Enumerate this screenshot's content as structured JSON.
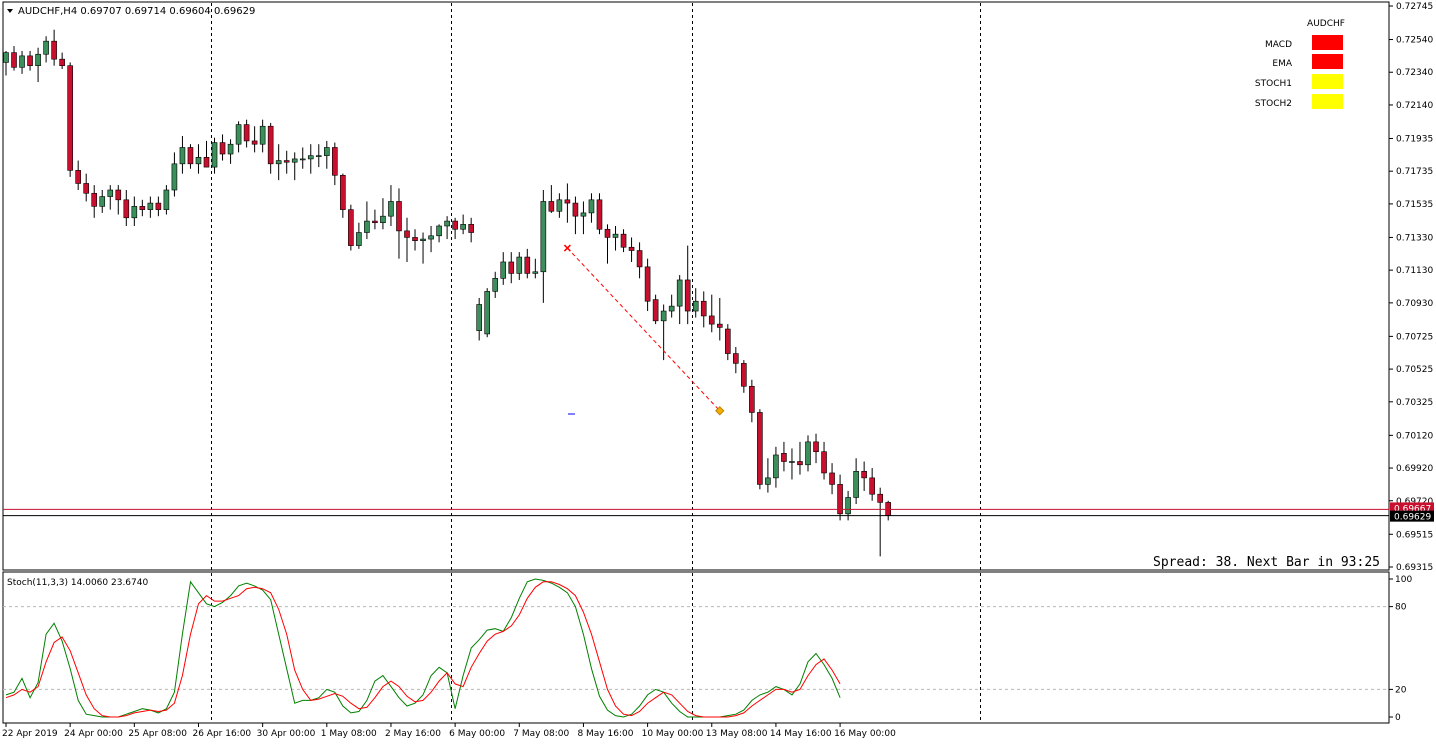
{
  "header": {
    "symbol_line": "AUDCHF,H4  0.69707 0.69714 0.69604 0.69629"
  },
  "status": {
    "spread_text": "Spread: 38. Next Bar in 93:25"
  },
  "dashboard": {
    "title": "AUDCHF",
    "rows": [
      {
        "label": "MACD",
        "color": "#ff0000"
      },
      {
        "label": "EMA",
        "color": "#ff0000"
      },
      {
        "label": "STOCH1",
        "color": "#ffff00"
      },
      {
        "label": "STOCH2",
        "color": "#ffff00"
      }
    ]
  },
  "stoch_label": "Stoch(11,3,3) 14.0060 23.6740",
  "colors": {
    "bull": "#3a8f5a",
    "bear": "#c8102e",
    "stoch_main": "#008000",
    "stoch_signal": "#ff0000",
    "bid_line": "#000000",
    "ask_line": "#c8102e",
    "trend_line": "#ff0000"
  },
  "chart_data": [
    {
      "type": "candlestick",
      "symbol": "AUDCHF",
      "timeframe": "H4",
      "ylim": [
        0.69315,
        0.72745
      ],
      "y_ticks": [
        "0.72745",
        "0.72540",
        "0.72340",
        "0.72140",
        "0.71935",
        "0.71735",
        "0.71535",
        "0.71330",
        "0.71130",
        "0.70930",
        "0.70725",
        "0.70525",
        "0.70325",
        "0.70120",
        "0.69920",
        "0.69720",
        "0.69515",
        "0.69315"
      ],
      "x_ticks": [
        {
          "index": 0,
          "label": "22 Apr 2019"
        },
        {
          "index": 8,
          "label": "24 Apr 00:00"
        },
        {
          "index": 16,
          "label": "25 Apr 08:00"
        },
        {
          "index": 24,
          "label": "26 Apr 16:00"
        },
        {
          "index": 32,
          "label": "30 Apr 00:00"
        },
        {
          "index": 40,
          "label": "1 May 08:00"
        },
        {
          "index": 48,
          "label": "2 May 16:00"
        },
        {
          "index": 56,
          "label": "6 May 00:00"
        },
        {
          "index": 64,
          "label": "7 May 08:00"
        },
        {
          "index": 72,
          "label": "8 May 16:00"
        },
        {
          "index": 80,
          "label": "10 May 00:00"
        },
        {
          "index": 88,
          "label": "13 May 08:00"
        },
        {
          "index": 96,
          "label": "14 May 16:00"
        },
        {
          "index": 104,
          "label": "16 May 00:00"
        }
      ],
      "price_labels": [
        {
          "value": 0.69667,
          "text": "0.69667",
          "color": "#c8102e"
        },
        {
          "value": 0.69629,
          "text": "0.69629",
          "color": "#000000"
        }
      ],
      "period_separators": [
        26,
        56,
        86,
        122
      ],
      "trendline": {
        "from": [
          70,
          0.71265
        ],
        "to": [
          89,
          0.7027
        ]
      },
      "candles": [
        {
          "o": 0.724,
          "h": 0.7247,
          "l": 0.7232,
          "c": 0.7246
        },
        {
          "o": 0.7246,
          "h": 0.725,
          "l": 0.7235,
          "c": 0.7237
        },
        {
          "o": 0.7237,
          "h": 0.7247,
          "l": 0.7233,
          "c": 0.7244
        },
        {
          "o": 0.7244,
          "h": 0.7247,
          "l": 0.7235,
          "c": 0.7238
        },
        {
          "o": 0.7238,
          "h": 0.7249,
          "l": 0.7228,
          "c": 0.7245
        },
        {
          "o": 0.7245,
          "h": 0.7256,
          "l": 0.724,
          "c": 0.7253
        },
        {
          "o": 0.7253,
          "h": 0.726,
          "l": 0.7238,
          "c": 0.7242
        },
        {
          "o": 0.7242,
          "h": 0.7246,
          "l": 0.7236,
          "c": 0.7238
        },
        {
          "o": 0.7238,
          "h": 0.724,
          "l": 0.717,
          "c": 0.7174
        },
        {
          "o": 0.7174,
          "h": 0.718,
          "l": 0.7162,
          "c": 0.7166
        },
        {
          "o": 0.7166,
          "h": 0.7172,
          "l": 0.7155,
          "c": 0.716
        },
        {
          "o": 0.716,
          "h": 0.7165,
          "l": 0.7145,
          "c": 0.7152
        },
        {
          "o": 0.7152,
          "h": 0.7162,
          "l": 0.7148,
          "c": 0.7158
        },
        {
          "o": 0.7158,
          "h": 0.7165,
          "l": 0.715,
          "c": 0.7162
        },
        {
          "o": 0.7162,
          "h": 0.7165,
          "l": 0.7147,
          "c": 0.7156
        },
        {
          "o": 0.7156,
          "h": 0.7162,
          "l": 0.714,
          "c": 0.7145
        },
        {
          "o": 0.7145,
          "h": 0.7158,
          "l": 0.714,
          "c": 0.7152
        },
        {
          "o": 0.7152,
          "h": 0.7156,
          "l": 0.7146,
          "c": 0.715
        },
        {
          "o": 0.715,
          "h": 0.7158,
          "l": 0.7145,
          "c": 0.7154
        },
        {
          "o": 0.7154,
          "h": 0.7158,
          "l": 0.7146,
          "c": 0.715
        },
        {
          "o": 0.715,
          "h": 0.7165,
          "l": 0.7147,
          "c": 0.7162
        },
        {
          "o": 0.7162,
          "h": 0.7185,
          "l": 0.7158,
          "c": 0.7178
        },
        {
          "o": 0.7178,
          "h": 0.7195,
          "l": 0.7172,
          "c": 0.7188
        },
        {
          "o": 0.7188,
          "h": 0.719,
          "l": 0.7175,
          "c": 0.7178
        },
        {
          "o": 0.7178,
          "h": 0.719,
          "l": 0.7172,
          "c": 0.7182
        },
        {
          "o": 0.7182,
          "h": 0.7192,
          "l": 0.7176,
          "c": 0.7176
        },
        {
          "o": 0.7176,
          "h": 0.7194,
          "l": 0.7172,
          "c": 0.7191
        },
        {
          "o": 0.7191,
          "h": 0.7196,
          "l": 0.718,
          "c": 0.7184
        },
        {
          "o": 0.7184,
          "h": 0.7193,
          "l": 0.7178,
          "c": 0.719
        },
        {
          "o": 0.719,
          "h": 0.7204,
          "l": 0.7185,
          "c": 0.7202
        },
        {
          "o": 0.7202,
          "h": 0.7205,
          "l": 0.7188,
          "c": 0.7192
        },
        {
          "o": 0.7192,
          "h": 0.7201,
          "l": 0.7185,
          "c": 0.719
        },
        {
          "o": 0.719,
          "h": 0.7205,
          "l": 0.7185,
          "c": 0.7201
        },
        {
          "o": 0.7201,
          "h": 0.7203,
          "l": 0.7172,
          "c": 0.7178
        },
        {
          "o": 0.7178,
          "h": 0.719,
          "l": 0.7168,
          "c": 0.718
        },
        {
          "o": 0.718,
          "h": 0.7186,
          "l": 0.7172,
          "c": 0.7179
        },
        {
          "o": 0.7179,
          "h": 0.7185,
          "l": 0.7168,
          "c": 0.7181
        },
        {
          "o": 0.7181,
          "h": 0.7188,
          "l": 0.7175,
          "c": 0.7181
        },
        {
          "o": 0.7181,
          "h": 0.719,
          "l": 0.7172,
          "c": 0.7183
        },
        {
          "o": 0.7183,
          "h": 0.719,
          "l": 0.7176,
          "c": 0.7183
        },
        {
          "o": 0.7183,
          "h": 0.7192,
          "l": 0.7175,
          "c": 0.7188
        },
        {
          "o": 0.7188,
          "h": 0.7191,
          "l": 0.7165,
          "c": 0.7171
        },
        {
          "o": 0.7171,
          "h": 0.7172,
          "l": 0.7145,
          "c": 0.715
        },
        {
          "o": 0.715,
          "h": 0.7153,
          "l": 0.7125,
          "c": 0.7128
        },
        {
          "o": 0.7128,
          "h": 0.7142,
          "l": 0.7126,
          "c": 0.7136
        },
        {
          "o": 0.7136,
          "h": 0.7155,
          "l": 0.7132,
          "c": 0.7143
        },
        {
          "o": 0.7143,
          "h": 0.715,
          "l": 0.7138,
          "c": 0.7142
        },
        {
          "o": 0.7142,
          "h": 0.7157,
          "l": 0.7138,
          "c": 0.7146
        },
        {
          "o": 0.7146,
          "h": 0.7165,
          "l": 0.714,
          "c": 0.7155
        },
        {
          "o": 0.7155,
          "h": 0.7163,
          "l": 0.712,
          "c": 0.7137
        },
        {
          "o": 0.7137,
          "h": 0.7145,
          "l": 0.7118,
          "c": 0.7133
        },
        {
          "o": 0.7133,
          "h": 0.7138,
          "l": 0.7125,
          "c": 0.7131
        },
        {
          "o": 0.7131,
          "h": 0.7136,
          "l": 0.7117,
          "c": 0.7132
        },
        {
          "o": 0.7132,
          "h": 0.714,
          "l": 0.7124,
          "c": 0.7134
        },
        {
          "o": 0.7134,
          "h": 0.7141,
          "l": 0.713,
          "c": 0.714
        },
        {
          "o": 0.714,
          "h": 0.7146,
          "l": 0.7132,
          "c": 0.7143
        },
        {
          "o": 0.7143,
          "h": 0.7145,
          "l": 0.7132,
          "c": 0.7138
        },
        {
          "o": 0.7138,
          "h": 0.7147,
          "l": 0.7135,
          "c": 0.7141
        },
        {
          "o": 0.7141,
          "h": 0.7145,
          "l": 0.713,
          "c": 0.7136
        },
        {
          "o": 0.7076,
          "h": 0.7096,
          "l": 0.707,
          "c": 0.7092
        },
        {
          "o": 0.7074,
          "h": 0.7102,
          "l": 0.7072,
          "c": 0.71
        },
        {
          "o": 0.71,
          "h": 0.7112,
          "l": 0.7096,
          "c": 0.7108
        },
        {
          "o": 0.7108,
          "h": 0.7124,
          "l": 0.7104,
          "c": 0.7118
        },
        {
          "o": 0.7118,
          "h": 0.7124,
          "l": 0.7105,
          "c": 0.7111
        },
        {
          "o": 0.7111,
          "h": 0.7124,
          "l": 0.7107,
          "c": 0.7121
        },
        {
          "o": 0.7121,
          "h": 0.7126,
          "l": 0.7108,
          "c": 0.7111
        },
        {
          "o": 0.7111,
          "h": 0.712,
          "l": 0.7108,
          "c": 0.7112
        },
        {
          "o": 0.7112,
          "h": 0.7162,
          "l": 0.7093,
          "c": 0.7155
        },
        {
          "o": 0.7155,
          "h": 0.7165,
          "l": 0.7148,
          "c": 0.7149
        },
        {
          "o": 0.7149,
          "h": 0.716,
          "l": 0.7145,
          "c": 0.7156
        },
        {
          "o": 0.7156,
          "h": 0.7166,
          "l": 0.7142,
          "c": 0.7154
        },
        {
          "o": 0.7154,
          "h": 0.7158,
          "l": 0.7135,
          "c": 0.7146
        },
        {
          "o": 0.7146,
          "h": 0.7155,
          "l": 0.7135,
          "c": 0.7148
        },
        {
          "o": 0.7148,
          "h": 0.716,
          "l": 0.7142,
          "c": 0.7156
        },
        {
          "o": 0.7156,
          "h": 0.716,
          "l": 0.7135,
          "c": 0.7138
        },
        {
          "o": 0.7138,
          "h": 0.7141,
          "l": 0.7117,
          "c": 0.7133
        },
        {
          "o": 0.7133,
          "h": 0.714,
          "l": 0.7125,
          "c": 0.7135
        },
        {
          "o": 0.7135,
          "h": 0.7138,
          "l": 0.7124,
          "c": 0.7127
        },
        {
          "o": 0.7127,
          "h": 0.7133,
          "l": 0.7118,
          "c": 0.7125
        },
        {
          "o": 0.7125,
          "h": 0.713,
          "l": 0.7108,
          "c": 0.7115
        },
        {
          "o": 0.7115,
          "h": 0.712,
          "l": 0.7088,
          "c": 0.7094
        },
        {
          "o": 0.7095,
          "h": 0.7098,
          "l": 0.708,
          "c": 0.7082
        },
        {
          "o": 0.7082,
          "h": 0.7092,
          "l": 0.7058,
          "c": 0.7088
        },
        {
          "o": 0.7088,
          "h": 0.7098,
          "l": 0.7084,
          "c": 0.7091
        },
        {
          "o": 0.7091,
          "h": 0.711,
          "l": 0.708,
          "c": 0.7107
        },
        {
          "o": 0.7107,
          "h": 0.7128,
          "l": 0.708,
          "c": 0.7088
        },
        {
          "o": 0.7088,
          "h": 0.7102,
          "l": 0.7084,
          "c": 0.7094
        },
        {
          "o": 0.7094,
          "h": 0.71,
          "l": 0.7078,
          "c": 0.7085
        },
        {
          "o": 0.7085,
          "h": 0.7098,
          "l": 0.7075,
          "c": 0.708
        },
        {
          "o": 0.708,
          "h": 0.7096,
          "l": 0.707,
          "c": 0.7078
        },
        {
          "o": 0.7077,
          "h": 0.708,
          "l": 0.7058,
          "c": 0.7062
        },
        {
          "o": 0.7062,
          "h": 0.7066,
          "l": 0.705,
          "c": 0.7056
        },
        {
          "o": 0.7056,
          "h": 0.7058,
          "l": 0.7038,
          "c": 0.7042
        },
        {
          "o": 0.7042,
          "h": 0.7046,
          "l": 0.702,
          "c": 0.7026
        },
        {
          "o": 0.7026,
          "h": 0.7028,
          "l": 0.6979,
          "c": 0.6982
        },
        {
          "o": 0.6982,
          "h": 0.6998,
          "l": 0.6977,
          "c": 0.6986
        },
        {
          "o": 0.6986,
          "h": 0.7005,
          "l": 0.698,
          "c": 0.7
        },
        {
          "o": 0.7001,
          "h": 0.7008,
          "l": 0.699,
          "c": 0.6996
        },
        {
          "o": 0.6996,
          "h": 0.7004,
          "l": 0.6985,
          "c": 0.6996
        },
        {
          "o": 0.6996,
          "h": 0.7008,
          "l": 0.6988,
          "c": 0.6994
        },
        {
          "o": 0.6994,
          "h": 0.7012,
          "l": 0.699,
          "c": 0.7008
        },
        {
          "o": 0.7008,
          "h": 0.7013,
          "l": 0.6995,
          "c": 0.7002
        },
        {
          "o": 0.7002,
          "h": 0.7008,
          "l": 0.6985,
          "c": 0.6989
        },
        {
          "o": 0.6989,
          "h": 0.6995,
          "l": 0.6976,
          "c": 0.6982
        },
        {
          "o": 0.6982,
          "h": 0.6988,
          "l": 0.696,
          "c": 0.6964
        },
        {
          "o": 0.6964,
          "h": 0.6978,
          "l": 0.696,
          "c": 0.6974
        },
        {
          "o": 0.6974,
          "h": 0.6998,
          "l": 0.697,
          "c": 0.699
        },
        {
          "o": 0.699,
          "h": 0.6996,
          "l": 0.6978,
          "c": 0.6986
        },
        {
          "o": 0.6986,
          "h": 0.6992,
          "l": 0.6972,
          "c": 0.6976
        },
        {
          "o": 0.6976,
          "h": 0.698,
          "l": 0.6938,
          "c": 0.6971
        },
        {
          "o": 0.6971,
          "h": 0.6972,
          "l": 0.696,
          "c": 0.6963
        }
      ]
    },
    {
      "type": "line",
      "name": "Stoch(11,3,3)",
      "ylim": [
        0,
        100
      ],
      "y_ticks": [
        "100",
        "80",
        "20",
        "0"
      ],
      "levels": [
        80,
        20
      ],
      "series": [
        {
          "name": "main",
          "values": [
            16,
            18,
            28,
            14,
            25,
            60,
            68,
            55,
            35,
            12,
            2,
            1,
            0,
            0,
            0,
            2,
            4,
            6,
            5,
            3,
            6,
            18,
            60,
            98,
            90,
            82,
            80,
            83,
            88,
            95,
            97,
            95,
            92,
            85,
            60,
            35,
            10,
            12,
            12,
            14,
            20,
            18,
            8,
            3,
            4,
            12,
            26,
            30,
            22,
            14,
            8,
            10,
            16,
            30,
            36,
            32,
            6,
            30,
            50,
            56,
            63,
            64,
            62,
            72,
            86,
            98,
            100,
            99,
            97,
            94,
            90,
            80,
            60,
            35,
            15,
            5,
            1,
            0,
            2,
            8,
            16,
            20,
            18,
            10,
            4,
            0,
            0,
            0,
            0,
            0,
            1,
            2,
            5,
            12,
            16,
            18,
            22,
            20,
            16,
            24,
            40,
            46,
            38,
            28,
            14
          ]
        },
        {
          "name": "signal",
          "values": [
            14,
            16,
            20,
            18,
            22,
            40,
            54,
            58,
            48,
            32,
            16,
            6,
            1,
            0,
            0,
            1,
            3,
            4,
            5,
            4,
            5,
            10,
            30,
            60,
            82,
            88,
            84,
            84,
            86,
            88,
            93,
            94,
            93,
            90,
            78,
            60,
            34,
            20,
            12,
            13,
            15,
            17,
            15,
            10,
            6,
            7,
            14,
            22,
            26,
            22,
            15,
            11,
            12,
            18,
            26,
            32,
            24,
            22,
            36,
            46,
            55,
            60,
            62,
            66,
            74,
            86,
            94,
            98,
            98,
            96,
            93,
            88,
            76,
            60,
            40,
            20,
            8,
            2,
            1,
            4,
            10,
            14,
            18,
            16,
            10,
            4,
            1,
            0,
            0,
            0,
            0,
            1,
            3,
            8,
            12,
            16,
            20,
            20,
            18,
            20,
            30,
            38,
            42,
            34,
            24
          ]
        }
      ]
    }
  ]
}
